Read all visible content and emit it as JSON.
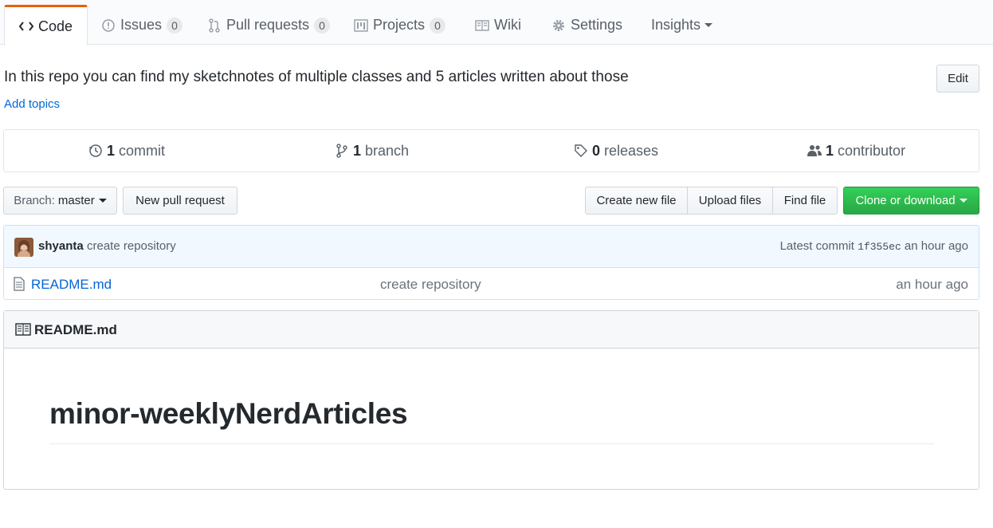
{
  "tabs": [
    {
      "label": "Code",
      "icon": "code-icon",
      "selected": true
    },
    {
      "label": "Issues",
      "icon": "issue-icon",
      "count": "0"
    },
    {
      "label": "Pull requests",
      "icon": "pull-request-icon",
      "count": "0"
    },
    {
      "label": "Projects",
      "icon": "project-icon",
      "count": "0"
    },
    {
      "label": "Wiki",
      "icon": "book-icon"
    },
    {
      "label": "Settings",
      "icon": "gear-icon"
    },
    {
      "label": "Insights",
      "icon": "chevron-down-icon"
    }
  ],
  "repo": {
    "description": "In this repo you can find my sketchnotes of multiple classes and 5 articles written about those",
    "add_topics": "Add topics",
    "edit_label": "Edit"
  },
  "summary": {
    "commits": {
      "count": "1",
      "label": "commit"
    },
    "branches": {
      "count": "1",
      "label": "branch"
    },
    "releases": {
      "count": "0",
      "label": "releases"
    },
    "contributors": {
      "count": "1",
      "label": "contributor"
    }
  },
  "toolbar": {
    "branch_label": "Branch:",
    "branch_value": "master",
    "new_pr": "New pull request",
    "create_file": "Create new file",
    "upload_files": "Upload files",
    "find_file": "Find file",
    "clone": "Clone or download"
  },
  "commit": {
    "author": "shyanta",
    "message": "create repository",
    "latest_label": "Latest commit",
    "sha": "1f355ec",
    "age": "an hour ago"
  },
  "files": [
    {
      "name": "README.md",
      "message": "create repository",
      "age": "an hour ago"
    }
  ],
  "readme": {
    "header": "README.md",
    "heading": "minor-weeklyNerdArticles"
  },
  "colors": {
    "link": "#0366d6",
    "accent_tab": "#e36209",
    "clone_green": "#28a745"
  }
}
